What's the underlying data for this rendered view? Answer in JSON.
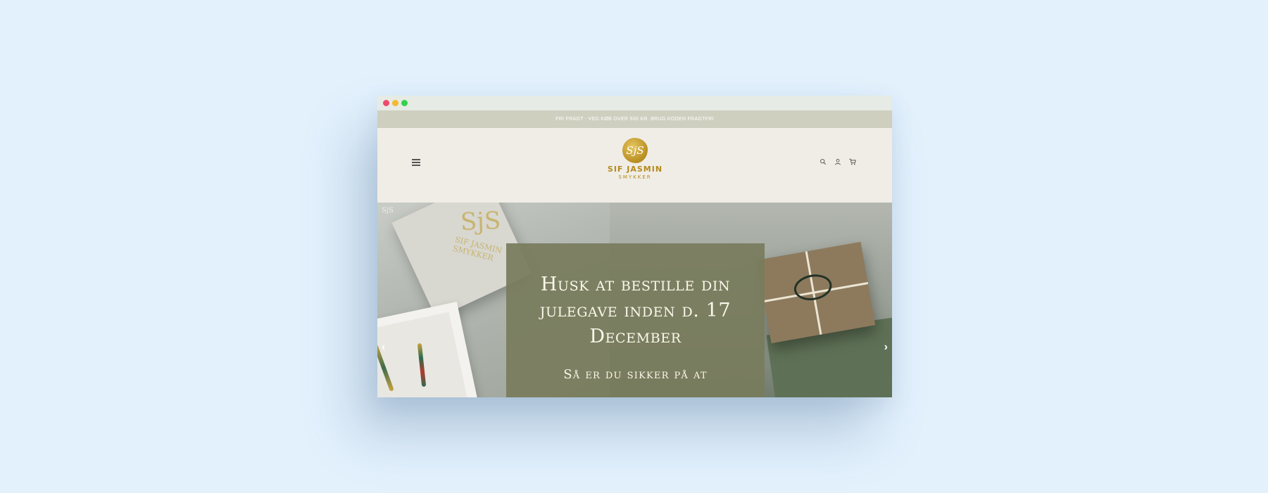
{
  "announcement": {
    "text": "Fri fragt - ved køb over 500 kr. Brug koden FRAGTFRI"
  },
  "logo": {
    "badge": "SjS",
    "name": "SIF JASMIN",
    "sub": "SMYKKER"
  },
  "header": {
    "icons": [
      "menu-icon",
      "search-icon",
      "account-icon",
      "cart-icon"
    ]
  },
  "hero": {
    "heading": "Husk at bestille din julegave inden d. 17 December",
    "subheading": "Så er du sikker på at",
    "box_logo": "SjS",
    "box_text": "SIF JASMIN\nSMYKKER",
    "slide_logo": "SjS",
    "arrow_left": "‹",
    "arrow_right": "›"
  },
  "colors": {
    "background": "#e3f1fd",
    "announcement_bar": "#cfcfc0",
    "header_bg": "#f0ede6",
    "logo_gold": "#b48a1d",
    "overlay": "#797c5c"
  }
}
